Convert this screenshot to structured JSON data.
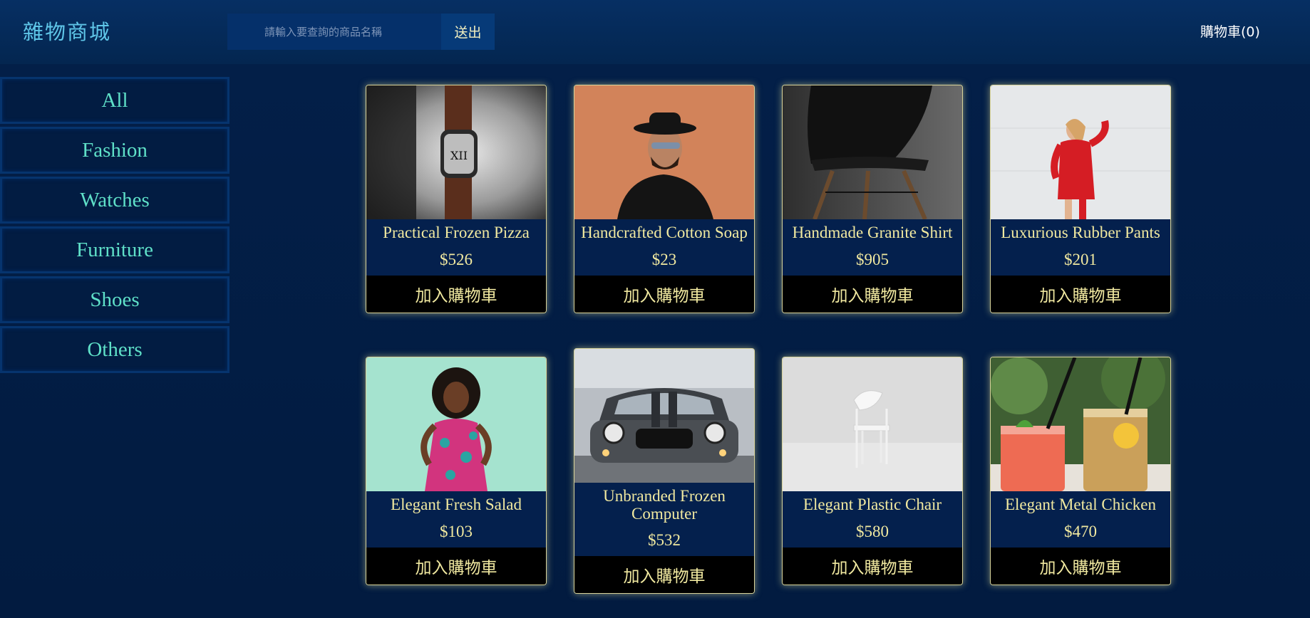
{
  "header": {
    "brand": "雜物商城",
    "search_placeholder": "請輸入要查詢的商品名稱",
    "search_button": "送出",
    "cart_label": "購物車(0)"
  },
  "sidebar": {
    "items": [
      {
        "label": "All"
      },
      {
        "label": "Fashion"
      },
      {
        "label": "Watches"
      },
      {
        "label": "Furniture"
      },
      {
        "label": "Shoes"
      },
      {
        "label": "Others"
      }
    ]
  },
  "products": [
    {
      "name": "Practical Frozen Pizza",
      "price": "$526",
      "button": "加入購物車",
      "image": "watch-photo"
    },
    {
      "name": "Handcrafted Cotton Soap",
      "price": "$23",
      "button": "加入購物車",
      "image": "man-with-hat-photo"
    },
    {
      "name": "Handmade Granite Shirt",
      "price": "$905",
      "button": "加入購物車",
      "image": "black-chair-photo"
    },
    {
      "name": "Luxurious Rubber Pants",
      "price": "$201",
      "button": "加入購物車",
      "image": "woman-red-sweater-photo"
    },
    {
      "name": "Elegant Fresh Salad",
      "price": "$103",
      "button": "加入購物車",
      "image": "woman-floral-dress-photo"
    },
    {
      "name": "Unbranded Frozen Computer",
      "price": "$532",
      "button": "加入購物車",
      "image": "mini-car-photo"
    },
    {
      "name": "Elegant Plastic Chair",
      "price": "$580",
      "button": "加入購物車",
      "image": "white-chair-photo"
    },
    {
      "name": "Elegant Metal Chicken",
      "price": "$470",
      "button": "加入購物車",
      "image": "drinks-photo"
    }
  ],
  "colors": {
    "accent_text": "#f1e9a0",
    "category_text": "#5fe0c8",
    "brand_text": "#5fc6e8",
    "background": "#021b40"
  }
}
